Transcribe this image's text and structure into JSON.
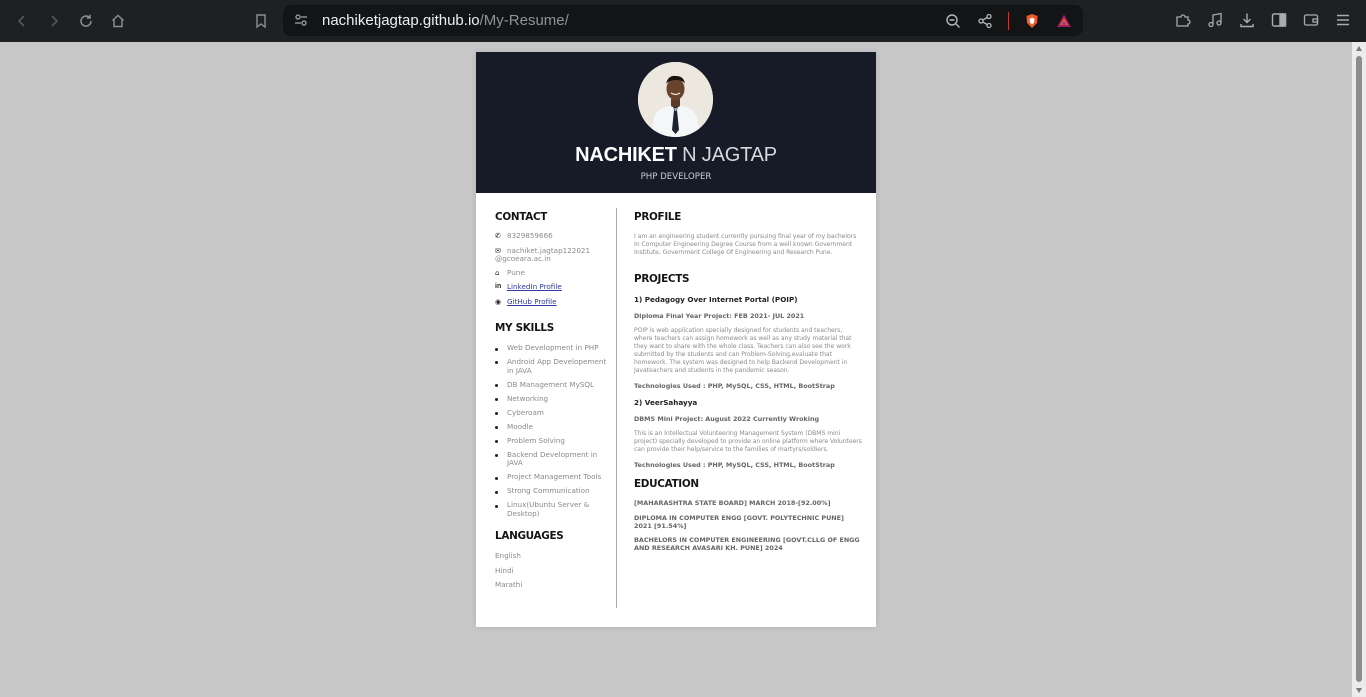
{
  "browser": {
    "url_host": "nachiketjagtap.github.io",
    "url_path": "/My-Resume/",
    "nav_icons": [
      "back-icon",
      "forward-icon",
      "reload-icon",
      "home-icon",
      "bookmark-icon"
    ],
    "url_actions": [
      "zoom-out-icon",
      "share-icon",
      "brave-shields-icon",
      "brave-rewards-icon"
    ],
    "toolbar_icons": [
      "extensions-icon",
      "media-icon",
      "download-icon",
      "sidebar-icon",
      "wallet-icon",
      "menu-icon"
    ]
  },
  "resume": {
    "name_first": "NACHIKET",
    "name_rest": " N JAGTAP",
    "role": "PHP DEVELOPER",
    "contact": {
      "title": "CONTACT",
      "phone": "8329859666",
      "email": "nachiket.jagtap122021 @gcoeara.ac.in",
      "location": "Pune",
      "linkedin": "LinkedIn Profile",
      "github": "GitHub Profile"
    },
    "skills": {
      "title": "MY SKILLS",
      "items": [
        "Web Development in PHP",
        "Android App Developement in JAVA",
        "DB Management MySQL",
        "Networking",
        "Cyberoam",
        "Moodle",
        "Problem Solving",
        "Backend Development in JAVA",
        "Project Management Tools",
        "Strong Communication",
        "Linux(Ubuntu Server & Desktop)"
      ]
    },
    "languages": {
      "title": "LANGUAGES",
      "items": [
        "English",
        "Hindi",
        "Marathi"
      ]
    },
    "profile": {
      "title": "PROFILE",
      "text": "I am an engineering student currently pursuing final year of my bachelors In Computer Engineering Degree Course from a well known Government Institute, Government College Of Engineering and Research Pune."
    },
    "projects": {
      "title": "PROJECTS",
      "items": [
        {
          "name": "1) Pedagogy Over Internet Portal (POIP)",
          "meta": "Diploma Final Year Project: FEB 2021- JUL 2021",
          "desc": "POIP is web application specially designed for students and teachers, where teachers can assign homework as well as any study material that they want to share with the whole class. Teachers can also see the work submitted by the students and can Problem-Solving,evaluate that homework. The system was designed to help Backend Development in Javateachers and students in the pandemic season.",
          "tech": "Technologies Used : PHP, MySQL, CSS, HTML, BootStrap"
        },
        {
          "name": "2) VeerSahayya",
          "meta": "DBMS Mini Project: August 2022 Currently Wroking",
          "desc": "This is an Intellectual Volunteering Management System (DBMS mini project) specially developed to provide an online platform where Volunteers can provide their help/service to the families of martyrs/soldiers.",
          "tech": "Technologies Used : PHP, MySQL, CSS, HTML, BootStrap"
        }
      ]
    },
    "education": {
      "title": "EDUCATION",
      "items": [
        "[MAHARASHTRA STATE BOARD] MARCH 2018-[92.00%]",
        "DIPLOMA IN COMPUTER ENGG [GOVT. POLYTECHNIC PUNE] 2021 [91.54%]",
        "BACHELORS IN COMPUTER ENGINEERING [GOVT.CLLG OF ENGG AND RESEARCH AVASARI KH. PUNE] 2024"
      ]
    }
  }
}
